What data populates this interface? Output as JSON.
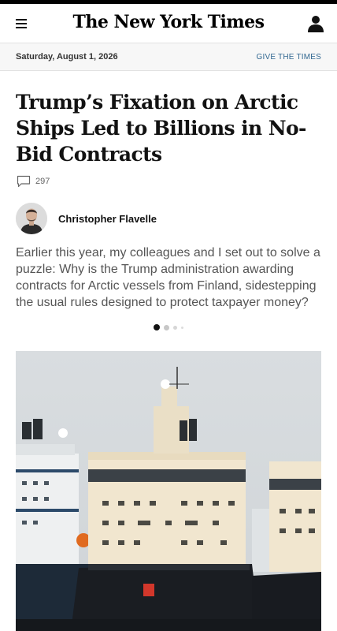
{
  "masthead": {
    "logo_text": "The New York Times",
    "menu_icon": "hamburger-menu-icon",
    "account_icon": "account-icon"
  },
  "dateline": {
    "date": "Saturday, August 1, 2026",
    "give_link": "GIVE THE TIMES"
  },
  "article": {
    "headline": "Trump’s Fixation on Arctic Ships Led to Billions in No-Bid Contracts",
    "comment_count": "297",
    "comment_icon": "comment-bubble-icon",
    "author": "Christopher Flavelle",
    "summary": "Earlier this year, my colleagues and I set out to solve a puzzle: Why is the Trump administration awarding contracts for Arctic vessels from Finland, sidestepping the usual rules designed to protect taxpayer money?"
  },
  "carousel": {
    "active_index": 1,
    "count": 4
  },
  "colors": {
    "link": "#326891",
    "text": "#121212",
    "summary_text": "#555555",
    "dateline_bg": "#f7f7f7"
  }
}
